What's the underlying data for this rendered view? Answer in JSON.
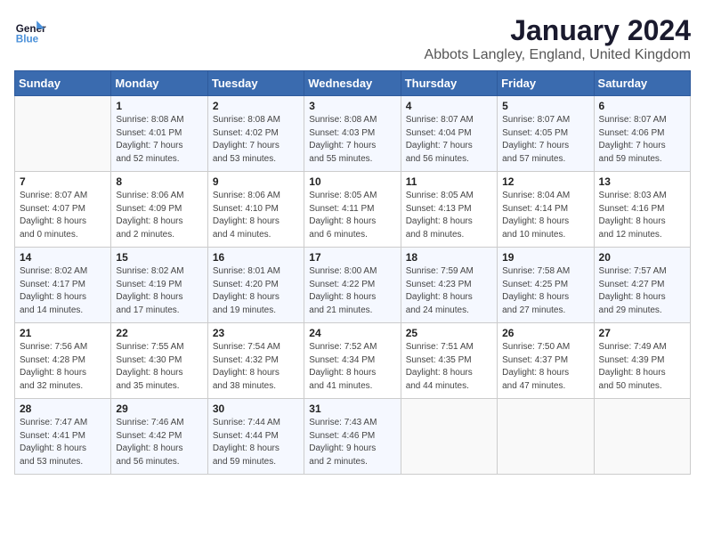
{
  "logo": {
    "line1": "General",
    "line2": "Blue"
  },
  "title": "January 2024",
  "subtitle": "Abbots Langley, England, United Kingdom",
  "days_of_week": [
    "Sunday",
    "Monday",
    "Tuesday",
    "Wednesday",
    "Thursday",
    "Friday",
    "Saturday"
  ],
  "weeks": [
    [
      {
        "num": "",
        "info": ""
      },
      {
        "num": "1",
        "info": "Sunrise: 8:08 AM\nSunset: 4:01 PM\nDaylight: 7 hours\nand 52 minutes."
      },
      {
        "num": "2",
        "info": "Sunrise: 8:08 AM\nSunset: 4:02 PM\nDaylight: 7 hours\nand 53 minutes."
      },
      {
        "num": "3",
        "info": "Sunrise: 8:08 AM\nSunset: 4:03 PM\nDaylight: 7 hours\nand 55 minutes."
      },
      {
        "num": "4",
        "info": "Sunrise: 8:07 AM\nSunset: 4:04 PM\nDaylight: 7 hours\nand 56 minutes."
      },
      {
        "num": "5",
        "info": "Sunrise: 8:07 AM\nSunset: 4:05 PM\nDaylight: 7 hours\nand 57 minutes."
      },
      {
        "num": "6",
        "info": "Sunrise: 8:07 AM\nSunset: 4:06 PM\nDaylight: 7 hours\nand 59 minutes."
      }
    ],
    [
      {
        "num": "7",
        "info": "Sunrise: 8:07 AM\nSunset: 4:07 PM\nDaylight: 8 hours\nand 0 minutes."
      },
      {
        "num": "8",
        "info": "Sunrise: 8:06 AM\nSunset: 4:09 PM\nDaylight: 8 hours\nand 2 minutes."
      },
      {
        "num": "9",
        "info": "Sunrise: 8:06 AM\nSunset: 4:10 PM\nDaylight: 8 hours\nand 4 minutes."
      },
      {
        "num": "10",
        "info": "Sunrise: 8:05 AM\nSunset: 4:11 PM\nDaylight: 8 hours\nand 6 minutes."
      },
      {
        "num": "11",
        "info": "Sunrise: 8:05 AM\nSunset: 4:13 PM\nDaylight: 8 hours\nand 8 minutes."
      },
      {
        "num": "12",
        "info": "Sunrise: 8:04 AM\nSunset: 4:14 PM\nDaylight: 8 hours\nand 10 minutes."
      },
      {
        "num": "13",
        "info": "Sunrise: 8:03 AM\nSunset: 4:16 PM\nDaylight: 8 hours\nand 12 minutes."
      }
    ],
    [
      {
        "num": "14",
        "info": "Sunrise: 8:02 AM\nSunset: 4:17 PM\nDaylight: 8 hours\nand 14 minutes."
      },
      {
        "num": "15",
        "info": "Sunrise: 8:02 AM\nSunset: 4:19 PM\nDaylight: 8 hours\nand 17 minutes."
      },
      {
        "num": "16",
        "info": "Sunrise: 8:01 AM\nSunset: 4:20 PM\nDaylight: 8 hours\nand 19 minutes."
      },
      {
        "num": "17",
        "info": "Sunrise: 8:00 AM\nSunset: 4:22 PM\nDaylight: 8 hours\nand 21 minutes."
      },
      {
        "num": "18",
        "info": "Sunrise: 7:59 AM\nSunset: 4:23 PM\nDaylight: 8 hours\nand 24 minutes."
      },
      {
        "num": "19",
        "info": "Sunrise: 7:58 AM\nSunset: 4:25 PM\nDaylight: 8 hours\nand 27 minutes."
      },
      {
        "num": "20",
        "info": "Sunrise: 7:57 AM\nSunset: 4:27 PM\nDaylight: 8 hours\nand 29 minutes."
      }
    ],
    [
      {
        "num": "21",
        "info": "Sunrise: 7:56 AM\nSunset: 4:28 PM\nDaylight: 8 hours\nand 32 minutes."
      },
      {
        "num": "22",
        "info": "Sunrise: 7:55 AM\nSunset: 4:30 PM\nDaylight: 8 hours\nand 35 minutes."
      },
      {
        "num": "23",
        "info": "Sunrise: 7:54 AM\nSunset: 4:32 PM\nDaylight: 8 hours\nand 38 minutes."
      },
      {
        "num": "24",
        "info": "Sunrise: 7:52 AM\nSunset: 4:34 PM\nDaylight: 8 hours\nand 41 minutes."
      },
      {
        "num": "25",
        "info": "Sunrise: 7:51 AM\nSunset: 4:35 PM\nDaylight: 8 hours\nand 44 minutes."
      },
      {
        "num": "26",
        "info": "Sunrise: 7:50 AM\nSunset: 4:37 PM\nDaylight: 8 hours\nand 47 minutes."
      },
      {
        "num": "27",
        "info": "Sunrise: 7:49 AM\nSunset: 4:39 PM\nDaylight: 8 hours\nand 50 minutes."
      }
    ],
    [
      {
        "num": "28",
        "info": "Sunrise: 7:47 AM\nSunset: 4:41 PM\nDaylight: 8 hours\nand 53 minutes."
      },
      {
        "num": "29",
        "info": "Sunrise: 7:46 AM\nSunset: 4:42 PM\nDaylight: 8 hours\nand 56 minutes."
      },
      {
        "num": "30",
        "info": "Sunrise: 7:44 AM\nSunset: 4:44 PM\nDaylight: 8 hours\nand 59 minutes."
      },
      {
        "num": "31",
        "info": "Sunrise: 7:43 AM\nSunset: 4:46 PM\nDaylight: 9 hours\nand 2 minutes."
      },
      {
        "num": "",
        "info": ""
      },
      {
        "num": "",
        "info": ""
      },
      {
        "num": "",
        "info": ""
      }
    ]
  ]
}
